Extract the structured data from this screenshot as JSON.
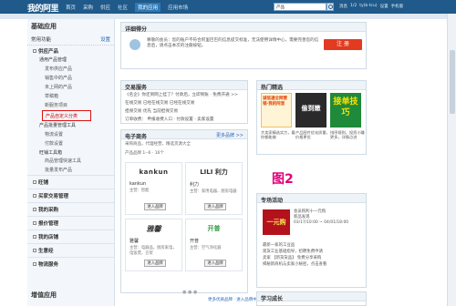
{
  "topbar": {
    "logo": "我的阿里",
    "nav": [
      "首页",
      "采购",
      "供应",
      "社区",
      "我的应用",
      "应用市场"
    ],
    "active_index": 4,
    "search_category": "产品",
    "user_items": [
      "消息",
      "1/2",
      "ty(b·tcu)",
      "设置",
      "手机版"
    ]
  },
  "sidebar": {
    "title": "基础应用",
    "common_label": "常用功能",
    "settings_link": "设置",
    "group_label": "供应产品",
    "cat1": "通用产品管理",
    "items1": [
      "发布供应产品",
      "销售中的产品",
      "未上网的产品",
      "草稿箱",
      "新服务项目"
    ],
    "highlight": "产品自定义分类",
    "cat2": "产品批量管理工具",
    "items2": [
      "物流设置",
      "付款设置"
    ],
    "cat3": "旺铺工具箱",
    "items3": [
      "商品管理快速工具",
      "批量发布产品"
    ],
    "mains": [
      "旺铺",
      "买家交易管理",
      "我的采购",
      "报价管理",
      "我的店铺",
      "生意经",
      "物流服务"
    ],
    "bottom_title": "增值应用"
  },
  "notice": {
    "title": "详细得分",
    "text": "尊敬的会员：您的账户不符合阿里巴巴的信息提交标准，无法使用详情中心，需要完善您的信息后，请点击本次的注册按钮。",
    "register_btn": "注 册"
  },
  "trade": {
    "title": "交易服务",
    "rows": [
      "《名企》你还到网上挂了？付款后，立即到账 · 免费开通 >>",
      "在线交易   已经在线交易   已经在线交易",
      "担保交易   优先   当前担保交易",
      "订单收费：   申报收费入口  · 付款设置  · 卖家设置"
    ]
  },
  "ecomm": {
    "title": "电子商务",
    "sub": "采购商品，代理经营，精选货源大全",
    "more": "更多品牌 >>",
    "filter": "产品品牌  1--6 · 16个",
    "tiles": [
      {
        "logo": "kankun",
        "name": "kankun",
        "desc": "主营：智能",
        "btn": "进入品牌"
      },
      {
        "logo": "LILI 利力",
        "name": "利力",
        "desc": "主营：家用电器、厨房电器",
        "btn": "进入品牌"
      },
      {
        "logo": "雅馨",
        "name": "雅馨",
        "desc": "主营：电器品，厨房家电，电饭煲，豆浆",
        "btn": "进入品牌"
      },
      {
        "logo": "开普",
        "name": "开普",
        "desc": "主营：空气净化器",
        "btn": "进入品牌"
      }
    ],
    "footer_link": "更多优质品牌 · 进入品牌中心"
  },
  "hot": {
    "title": "热门精选",
    "ads": [
      {
        "text": "诚信通全网营销·我的阿里",
        "caption": "大卖家精选实力，看你都能做"
      },
      {
        "text": "接单技巧",
        "caption": "排序规则，投资小赚更多，详情点进"
      },
      {
        "text": "偷到嫩",
        "caption": "产品图片优化质量，价格更优"
      }
    ]
  },
  "fig_label": "图2",
  "events": {
    "title": "专场活动",
    "img_text": "一元购",
    "headline": "会员购利十一元购",
    "sub": "新品发现",
    "date": "03/17/10:00 ~ 04/01/18:00",
    "list": [
      "最新一家的工业品",
      "现货工业基础指导，招聘免费申请",
      "卖家 【新货货品】 免费分享采购",
      "揭秘新商机与卖家小秘密，点击查看"
    ]
  },
  "learn": {
    "title": "学习成长"
  }
}
